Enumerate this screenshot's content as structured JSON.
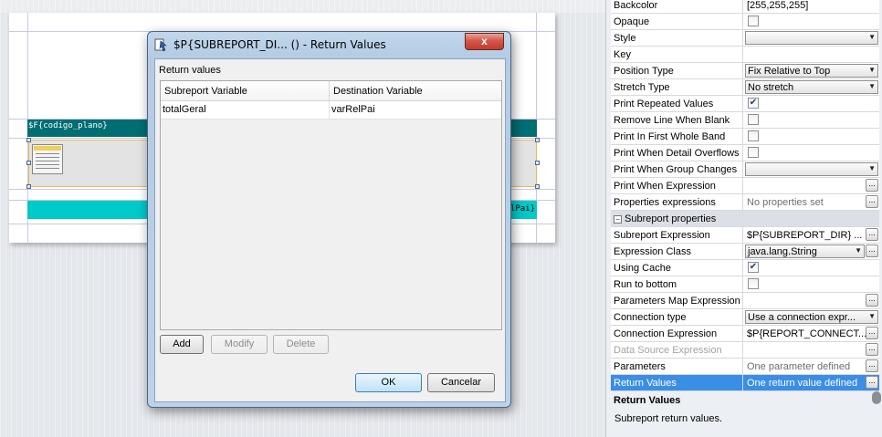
{
  "designer": {
    "group_field": "$F{codigo_plano}",
    "teal_band_text": "lPai}"
  },
  "properties": {
    "rows": [
      {
        "name": "Backcolor",
        "kind": "text",
        "value": "[255,255,255]"
      },
      {
        "name": "Opaque",
        "kind": "check",
        "checked": false
      },
      {
        "name": "Style",
        "kind": "combo",
        "value": ""
      },
      {
        "name": "Key",
        "kind": "text",
        "value": ""
      },
      {
        "name": "Position Type",
        "kind": "combo",
        "value": "Fix Relative to Top"
      },
      {
        "name": "Stretch Type",
        "kind": "combo",
        "value": "No stretch"
      },
      {
        "name": "Print Repeated Values",
        "kind": "check",
        "checked": true
      },
      {
        "name": "Remove Line When Blank",
        "kind": "check",
        "checked": false
      },
      {
        "name": "Print In First Whole Band",
        "kind": "check",
        "checked": false
      },
      {
        "name": "Print When Detail Overflows",
        "kind": "check",
        "checked": false
      },
      {
        "name": "Print When Group Changes",
        "kind": "combo",
        "value": ""
      },
      {
        "name": "Print When Expression",
        "kind": "ellipsis",
        "value": ""
      },
      {
        "name": "Properties expressions",
        "kind": "ellipsis",
        "value": "No properties set",
        "muted": true
      }
    ],
    "section": {
      "label": "Subreport properties",
      "toggle": "−"
    },
    "section_rows": [
      {
        "name": "Subreport Expression",
        "kind": "ellipsis",
        "value": "$P{SUBREPORT_DIR} ..."
      },
      {
        "name": "Expression Class",
        "kind": "combo-ellipsis",
        "value": "java.lang.String"
      },
      {
        "name": "Using Cache",
        "kind": "check",
        "checked": true
      },
      {
        "name": "Run to bottom",
        "kind": "check",
        "checked": false
      },
      {
        "name": "Parameters Map Expression",
        "kind": "ellipsis",
        "value": ""
      },
      {
        "name": "Connection type",
        "kind": "combo",
        "value": "Use a connection expr..."
      },
      {
        "name": "Connection Expression",
        "kind": "ellipsis",
        "value": "$P{REPORT_CONNECT..."
      },
      {
        "name": "Data Source Expression",
        "kind": "ellipsis",
        "value": "",
        "dim": true
      },
      {
        "name": "Parameters",
        "kind": "ellipsis",
        "value": "One parameter defined",
        "muted": true
      },
      {
        "name": "Return Values",
        "kind": "ellipsis",
        "value": "One return value defined",
        "selected": true
      }
    ],
    "help": {
      "title": "Return Values",
      "text": "Subreport return values."
    }
  },
  "dialog": {
    "title": "$P{SUBREPORT_DI... () - Return Values",
    "close_label": "x",
    "section_label": "Return values",
    "columns": [
      "Subreport Variable",
      "Destination Variable"
    ],
    "rows": [
      {
        "subreport_variable": "totalGeral",
        "destination_variable": "varRelPai"
      }
    ],
    "buttons": {
      "add": "Add",
      "modify": "Modify",
      "delete": "Delete",
      "ok": "OK",
      "cancel": "Cancelar"
    }
  }
}
